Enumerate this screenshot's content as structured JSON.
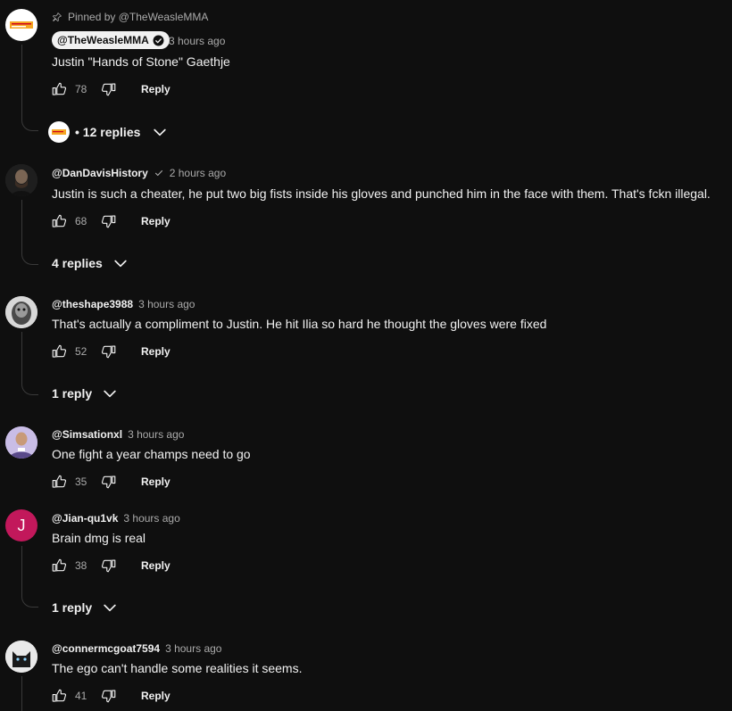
{
  "pinned": {
    "pinned_label": "Pinned by @TheWeasleMMA",
    "handle": "@TheWeasleMMA",
    "time": "3 hours ago",
    "text": "Justin \"Hands of Stone\" Gaethje",
    "likes": "78",
    "reply_label": "Reply",
    "replies_label": "• 12 replies"
  },
  "comments": [
    {
      "handle": "@DanDavisHistory",
      "time": "2 hours ago",
      "text": "Justin is such a cheater, he put two big fists inside his gloves and punched him in the face with them. That's fckn illegal.",
      "likes": "68",
      "reply_label": "Reply",
      "replies_label": "4 replies"
    },
    {
      "handle": "@theshape3988",
      "time": "3 hours ago",
      "text": "That's actually a compliment to Justin. He hit Ilia so hard he thought the gloves were fixed",
      "likes": "52",
      "reply_label": "Reply",
      "replies_label": "1 reply"
    },
    {
      "handle": "@Simsationxl",
      "time": "3 hours ago",
      "text": "One fight a year champs need to go",
      "likes": "35",
      "reply_label": "Reply"
    },
    {
      "handle": "@Jian-qu1vk",
      "time": "3 hours ago",
      "text": "Brain dmg is real",
      "likes": "38",
      "reply_label": "Reply",
      "replies_label": "1 reply",
      "avatar_letter": "J"
    },
    {
      "handle": "@connermcgoat7594",
      "time": "3 hours ago",
      "text": "The ego can't handle some realities it seems.",
      "likes": "41",
      "reply_label": "Reply"
    }
  ],
  "icons": {
    "pin": "pin-icon",
    "verified": "verified-check-icon",
    "like": "thumbs-up-icon",
    "dislike": "thumbs-down-icon",
    "chevron": "chevron-down-icon"
  },
  "colors": {
    "background": "#0f0f0f",
    "text": "#f1f1f1",
    "secondary": "#aaaaaa",
    "avatar_j": "#c2185b",
    "logo_accent": "#f5a623"
  }
}
